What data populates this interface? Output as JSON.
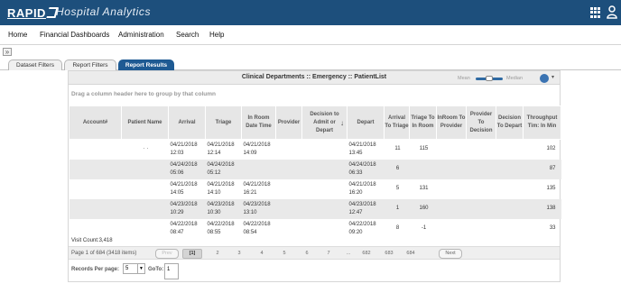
{
  "app": {
    "logo": "RAPID",
    "title": "Hospital Analytics"
  },
  "menu": [
    "Home",
    "Financial Dashboards",
    "Administration",
    "Search",
    "Help"
  ],
  "collapse_glyph": "»",
  "tabs": [
    "Dataset Filters",
    "Report Filters",
    "Report Results"
  ],
  "active_tab": "Report Results",
  "panel": {
    "title": "Clinical Departments :: Emergency :: PatientList",
    "toggle_left": "Mean",
    "toggle_right": "Median",
    "group_hint": "Drag a column header here to group by that column",
    "sort_glyph": "↓"
  },
  "columns": {
    "account": "Account#",
    "patient": "Patient Name",
    "arrival": "Arrival",
    "triage": "Triage",
    "inroom": "In Room Date Time",
    "provider": "Provider",
    "decision": "Decision to Admit or Depart",
    "depart": "Depart",
    "a2t": "Arrival To Triage",
    "t2i": "Triage To In Room",
    "i2p": "InRoom To Provider",
    "p2d": "Provider To Decision",
    "d2d": "Decision To Depart",
    "throughput": "Throughput Tim: In Min"
  },
  "rows": [
    {
      "account": "",
      "patient": "· ·",
      "arrival": "04/21/2018 12:03",
      "triage": "04/21/2018 12:14",
      "inroom": "04/21/2018 14:09",
      "provider": "",
      "decision": "",
      "depart": "04/21/2018 13:45",
      "a2t": "11",
      "t2i": "115",
      "i2p": "",
      "p2d": "",
      "d2d": "",
      "throughput": "102"
    },
    {
      "account": "",
      "patient": "",
      "arrival": "04/24/2018 05:06",
      "triage": "04/24/2018 05:12",
      "inroom": "",
      "provider": "",
      "decision": "",
      "depart": "04/24/2018 06:33",
      "a2t": "6",
      "t2i": "",
      "i2p": "",
      "p2d": "",
      "d2d": "",
      "throughput": "87"
    },
    {
      "account": "",
      "patient": "",
      "arrival": "04/21/2018 14:05",
      "triage": "04/21/2018 14:10",
      "inroom": "04/21/2018 16:21",
      "provider": "",
      "decision": "",
      "depart": "04/21/2018 16:20",
      "a2t": "5",
      "t2i": "131",
      "i2p": "",
      "p2d": "",
      "d2d": "",
      "throughput": "135"
    },
    {
      "account": "",
      "patient": "",
      "arrival": "04/23/2018 10:29",
      "triage": "04/23/2018 10:30",
      "inroom": "04/23/2018 13:10",
      "provider": "",
      "decision": "",
      "depart": "04/23/2018 12:47",
      "a2t": "1",
      "t2i": "160",
      "i2p": "",
      "p2d": "",
      "d2d": "",
      "throughput": "138"
    },
    {
      "account": "",
      "patient": "",
      "arrival": "04/22/2018 08:47",
      "triage": "04/22/2018 08:55",
      "inroom": "04/22/2018 08:54",
      "provider": "",
      "decision": "",
      "depart": "04/22/2018 09:20",
      "a2t": "8",
      "t2i": "-1",
      "i2p": "",
      "p2d": "",
      "d2d": "",
      "throughput": "33"
    }
  ],
  "visit_count": "Visit Count:3,418",
  "pager": {
    "info": "Page 1 of 684 (3418 items)",
    "prev": "Prev",
    "current": "[1]",
    "pages": [
      "2",
      "3",
      "4",
      "5",
      "6",
      "7",
      "...",
      "682",
      "683",
      "684"
    ],
    "next": "Next"
  },
  "records_per_page": {
    "label": "Records Per page:",
    "value": "5",
    "goto_label": "GoTo:",
    "goto_value": "1"
  },
  "colors": {
    "topbar": "#1d4f7c",
    "active_tab": "#1e5a93",
    "gear": "#3a73b2"
  },
  "icons": [
    "apps-grid-icon",
    "user-icon",
    "gear-icon",
    "sort-down-icon",
    "chevron-down-icon"
  ]
}
